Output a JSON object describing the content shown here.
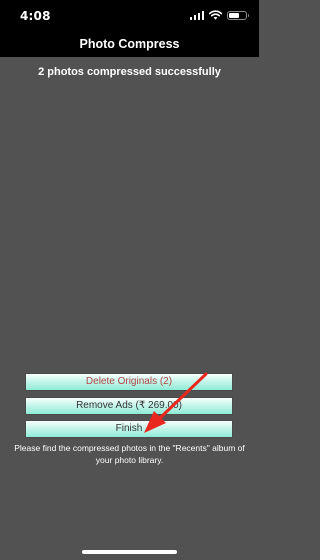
{
  "status_bar": {
    "time": "4:08"
  },
  "nav": {
    "title": "Photo Compress"
  },
  "main": {
    "message": "2 photos compressed successfully",
    "buttons": {
      "delete_originals": "Delete Originals (2)",
      "remove_ads": "Remove Ads (₹ 269.00)",
      "finish": "Finish"
    },
    "info_text": "Please find the compressed photos in the \"Recents\" album of your photo library."
  },
  "colors": {
    "background": "#525252",
    "bar": "#000000",
    "button_gradient_top": "#f8fffd",
    "button_gradient_bottom": "#8eecd6",
    "delete_text": "#b04545",
    "annotation_arrow": "#e8281e"
  },
  "icons": [
    "signal-icon",
    "wifi-icon",
    "battery-icon",
    "arrow-annotation"
  ]
}
